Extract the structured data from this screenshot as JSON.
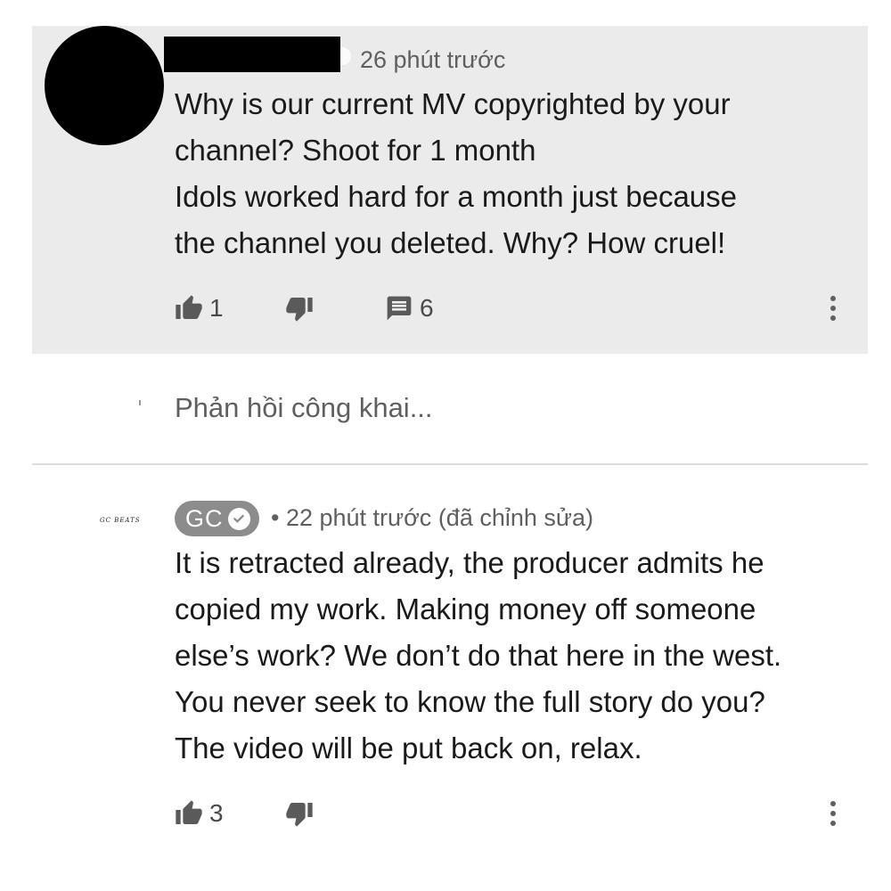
{
  "comments": [
    {
      "time": "26 phút trước",
      "text": "Why is our current MV copyrighted by your\nchannel? Shoot for 1 month\n Idols worked hard for a month just because\nthe channel you deleted. Why? How cruel!",
      "likes": "1",
      "replies": "6",
      "highlighted": true,
      "avatar_color": "#000000",
      "author_redacted": true
    },
    {
      "author_badge": "GC",
      "avatar_text": "GC BEATS",
      "time": "• 22 phút trước (đã chỉnh sửa)",
      "text": "It is retracted already, the producer admits he\ncopied my work. Making money off someone\nelse’s work? We don’t do that here in the west.\nYou never seek to know the full story do you?\nThe video will be put back on, relax.",
      "likes": "3",
      "verified": true
    }
  ],
  "reply_box": {
    "placeholder": "Phản hồi công khai..."
  },
  "icons": {
    "like": "thumbs-up-icon",
    "dislike": "thumbs-down-icon",
    "reply": "comment-icon",
    "more": "more-vert-icon",
    "verified": "check-circle-icon"
  },
  "colors": {
    "highlight_bg": "#ebebeb",
    "badge_bg": "#8c8c8c",
    "secondary_text": "#5f5f5f"
  }
}
